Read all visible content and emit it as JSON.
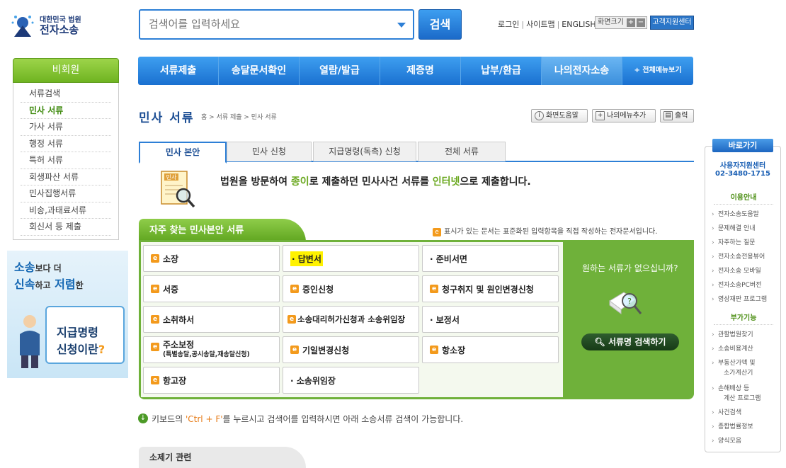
{
  "header": {
    "logo_small": "대한민국 법원",
    "logo_main": "전자소송",
    "search_placeholder": "검색어를 입력하세요",
    "search_button": "검색",
    "links": [
      "로그인",
      "사이트맵",
      "ENGLISH"
    ],
    "font_size_label": "화면크기",
    "font_plus": "+",
    "font_minus": "−",
    "support_button": "고객지원센터"
  },
  "left_nav": {
    "header": "비회원",
    "items": [
      "서류검색",
      "민사 서류",
      "가사 서류",
      "행정 서류",
      "특허 서류",
      "회생파산 서류",
      "민사집행서류",
      "비송,과태료서류",
      "회신서 등 제출"
    ],
    "active_index": 1
  },
  "banner": {
    "line1_a": "소송",
    "line1_b": "보다 더",
    "line2_a": "신속",
    "line2_b": "하고",
    "line2_c": "저렴",
    "line2_d": "한",
    "cal_line1": "지급명령",
    "cal_line2": "신청이란",
    "cal_q": "?"
  },
  "top_nav": {
    "items": [
      "서류제출",
      "송달문서확인",
      "열람/발급",
      "제증명",
      "납부/환급",
      "나의전자소송"
    ],
    "all_menu": "+ 전체메뉴보기",
    "active_index": 5
  },
  "page": {
    "title": "민사 서류",
    "breadcrumb": "홈 > 서류 제출 > 민사 서류",
    "tools": [
      "화면도움말",
      "나의메뉴추가",
      "출력"
    ]
  },
  "tabs": [
    "민사 본안",
    "민사 신청",
    "지급명령(독촉) 신청",
    "전체 서류"
  ],
  "intro": {
    "icon_label": "민사",
    "a": "법원을 방문하여 ",
    "b": "종이",
    "c": "로 제출하던 민사사건 서류를 ",
    "d": "인터넷",
    "e": "으로 제출합니다."
  },
  "docs": {
    "header": "자주 찾는 민사본안 서류",
    "note": "표시가 있는 문서는 표준화된 입력항목을 직접 작성하는 전자문서입니다.",
    "e_icon": "e",
    "cells": [
      {
        "label": "소장",
        "e": true
      },
      {
        "label": "· 답변서",
        "e": false,
        "highlight": true
      },
      {
        "label": "· 준비서면",
        "e": false
      },
      {
        "label": "서증",
        "e": true
      },
      {
        "label": "증인신청",
        "e": true
      },
      {
        "label": "청구취지 및 원인변경신청",
        "e": true
      },
      {
        "label": "소취하서",
        "e": true
      },
      {
        "label": "소송대리허가신청과 소송위임장",
        "e": true
      },
      {
        "label": "· 보정서",
        "e": false
      },
      {
        "label": "주소보정",
        "sub": "(특별송달,공시송달,재송달신청)",
        "e": true
      },
      {
        "label": "기일변경신청",
        "e": true
      },
      {
        "label": "항소장",
        "e": true
      },
      {
        "label": "항고장",
        "e": true
      },
      {
        "label": "· 소송위임장",
        "e": false
      }
    ],
    "side_question": "원하는 서류가 없으십니까?",
    "side_button": "서류명 검색하기"
  },
  "keyboard_tip": {
    "a": "키보드의 ",
    "b": "'Ctrl + F'",
    "c": "를 누르시고 검색어를 입력하시면 아래 소송서류 검색이 가능합니다."
  },
  "section2": "소제기 관련",
  "quick": {
    "header": "바로가기",
    "center": "사용자지원센터",
    "phone": "02-3480-1715",
    "guide_title": "이용안내",
    "guide_items": [
      "전자소송도움말",
      "문제해결 안내",
      "자주하는 질문",
      "전자소송전용뷰어",
      "전자소송 모바일",
      "전자소송PC버전",
      "영상재판 프로그램"
    ],
    "tools_title": "부가기능",
    "tools_items": [
      "관할법원찾기",
      "소송비용계산",
      "부동산가액 및",
      "소가계산기",
      "손해배상 등",
      "계산 프로그램",
      "사건검색",
      "종합법률정보",
      "양식모음"
    ]
  },
  "colors": {
    "brand_blue": "#2d7fd6",
    "green": "#6fb13a",
    "highlight": "#fff200",
    "orange": "#e67a16"
  }
}
